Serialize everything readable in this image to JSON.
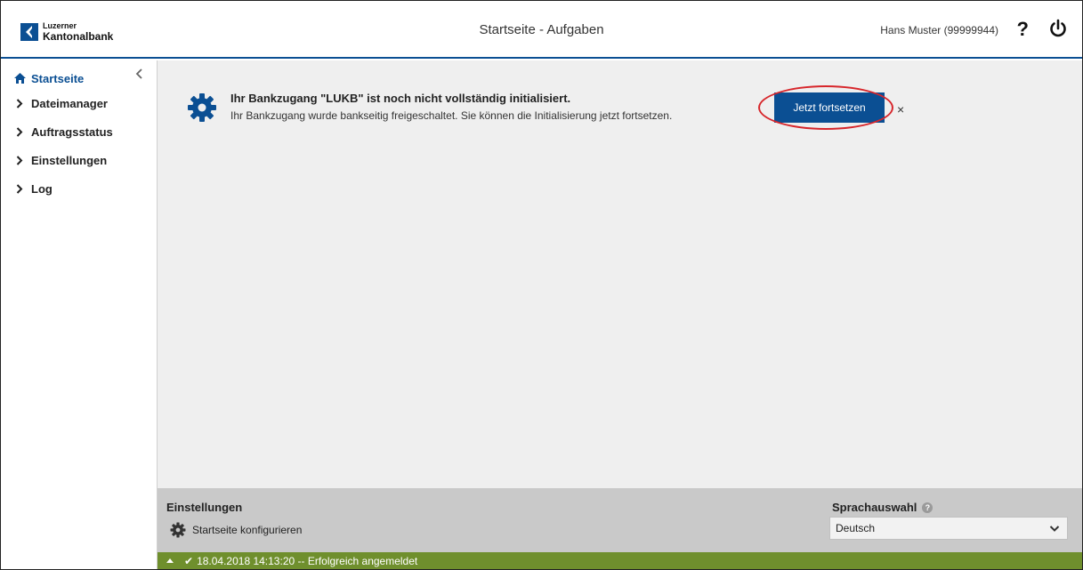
{
  "header": {
    "logo_small": "Luzerner",
    "logo_big": "Kantonalbank",
    "title": "Startseite - Aufgaben",
    "user": "Hans Muster (99999944)",
    "help_icon": "?",
    "power_icon": "power-icon"
  },
  "sidebar": {
    "items": [
      {
        "label": "Startseite",
        "icon": "home-icon",
        "active": true
      },
      {
        "label": "Dateimanager",
        "icon": "chevron-right-icon"
      },
      {
        "label": "Auftragsstatus",
        "icon": "chevron-right-icon"
      },
      {
        "label": "Einstellungen",
        "icon": "chevron-right-icon"
      },
      {
        "label": "Log",
        "icon": "chevron-right-icon"
      }
    ]
  },
  "notice": {
    "title": "Ihr Bankzugang \"LUKB\" ist noch nicht vollständig initialisiert.",
    "text": "Ihr Bankzugang wurde bankseitig freigeschaltet. Sie können die Initialisierung jetzt fortsetzen.",
    "button_label": "Jetzt fortsetzen",
    "close_icon": "×"
  },
  "footer": {
    "settings_title": "Einstellungen",
    "config_label": "Startseite konfigurieren",
    "language_label": "Sprachauswahl",
    "info_icon": "?",
    "language_value": "Deutsch"
  },
  "status": {
    "check_icon": "✔",
    "message": "18.04.2018 14:13:20 -- Erfolgreich angemeldet"
  },
  "colors": {
    "brand_blue": "#0b4f93",
    "status_green": "#6f8f2d",
    "annotation_red": "#d7262b",
    "main_bg": "#efefef",
    "footer_bg": "#c9c9c9"
  }
}
